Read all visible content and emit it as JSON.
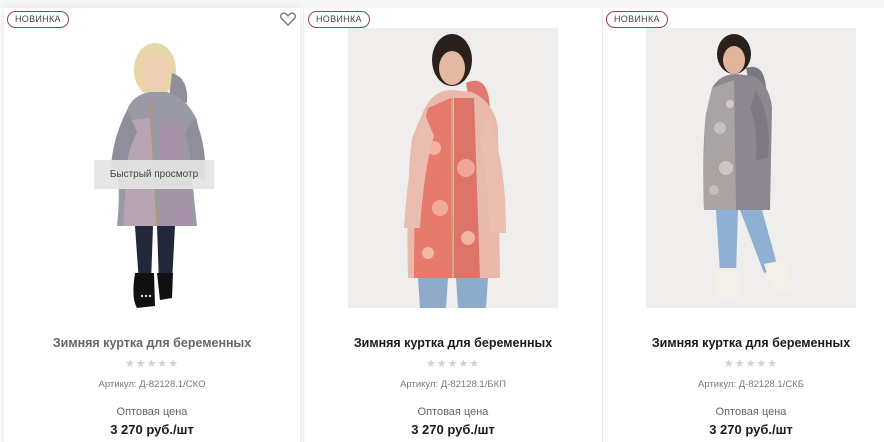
{
  "products": [
    {
      "badge": "НОВИНКА",
      "title": "Зимняя куртка для беременных",
      "rating_stars": "★★★★★",
      "sku": "Артикул: Д-82128.1/СКО",
      "price_label": "Оптовая цена",
      "price": "3 270 руб./шт",
      "quick_view": "Быстрый просмотр",
      "favorite_icon": "heart-icon",
      "rating": 0
    },
    {
      "badge": "НОВИНКА",
      "title": "Зимняя куртка для беременных",
      "rating_stars": "★★★★★",
      "sku": "Артикул: Д-82128.1/БКП",
      "price_label": "Оптовая цена",
      "price": "3 270 руб./шт",
      "rating": 0
    },
    {
      "badge": "НОВИНКА",
      "title": "Зимняя куртка для беременных",
      "rating_stars": "★★★★★",
      "sku": "Артикул: Д-82128.1/СКБ",
      "price_label": "Оптовая цена",
      "price": "3 270 руб./шт",
      "rating": 0
    }
  ],
  "colors": {
    "badge_border": "#a33b4f",
    "star_empty": "#d0d0d0"
  }
}
